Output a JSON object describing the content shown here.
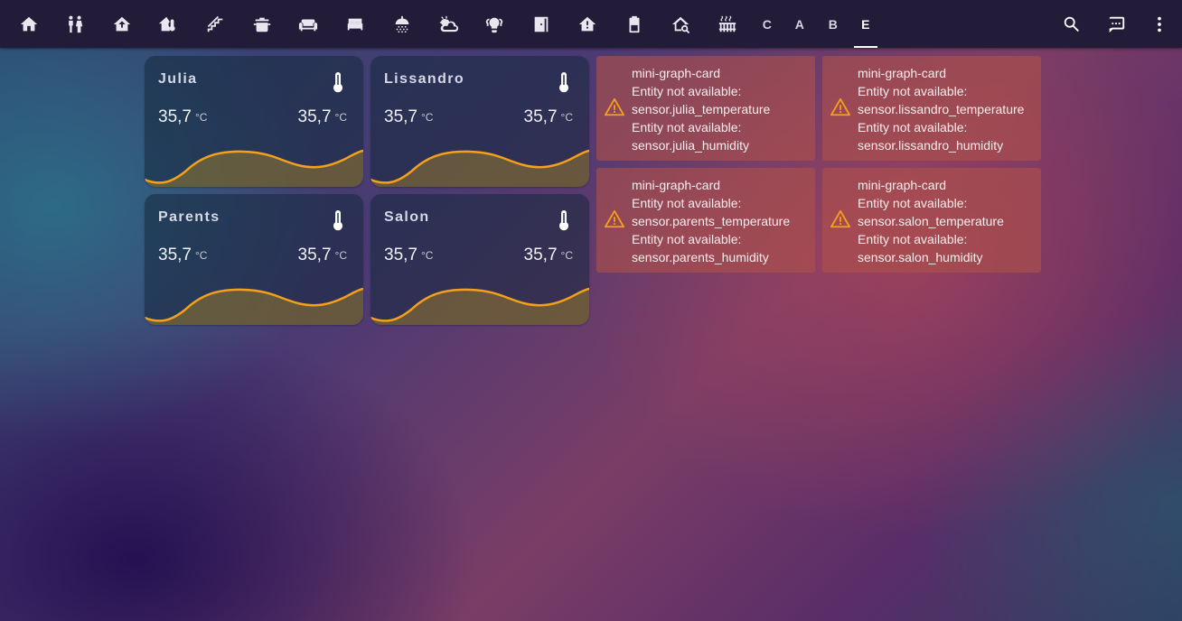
{
  "topbar": {
    "tabs": [
      {
        "name": "home-icon"
      },
      {
        "name": "family-icon"
      },
      {
        "name": "home-upload-icon"
      },
      {
        "name": "home-thermometer-icon"
      },
      {
        "name": "stairs-icon"
      },
      {
        "name": "pot-icon"
      },
      {
        "name": "sofa-icon"
      },
      {
        "name": "bed-icon"
      },
      {
        "name": "shower-icon"
      },
      {
        "name": "weather-icon"
      },
      {
        "name": "lightbulb-group-icon"
      },
      {
        "name": "door-icon"
      },
      {
        "name": "home-alert-icon"
      },
      {
        "name": "battery-icon"
      },
      {
        "name": "home-search-icon"
      },
      {
        "name": "radiator-icon"
      }
    ],
    "letter_tabs": [
      "C",
      "A",
      "B",
      "E"
    ],
    "active_tab": "E",
    "actions": [
      "search-icon",
      "message-icon",
      "more-vert-icon"
    ]
  },
  "sensor_cards": [
    {
      "name": "Julia",
      "temperature": "35,7",
      "temp_unit": "°C",
      "humidity": "35,7",
      "hum_unit": "°C"
    },
    {
      "name": "Lissandro",
      "temperature": "35,7",
      "temp_unit": "°C",
      "humidity": "35,7",
      "hum_unit": "°C"
    },
    {
      "name": "Parents",
      "temperature": "35,7",
      "temp_unit": "°C",
      "humidity": "35,7",
      "hum_unit": "°C"
    },
    {
      "name": "Salon",
      "temperature": "35,7",
      "temp_unit": "°C",
      "humidity": "35,7",
      "hum_unit": "°C"
    }
  ],
  "error_cards": [
    {
      "lines": [
        "mini-graph-card",
        "Entity not available:",
        "sensor.julia_temperature",
        "Entity not available:",
        "sensor.julia_humidity"
      ]
    },
    {
      "lines": [
        "mini-graph-card",
        "Entity not available:",
        "sensor.lissandro_temperature",
        "Entity not available:",
        "sensor.lissandro_humidity"
      ]
    },
    {
      "lines": [
        "mini-graph-card",
        "Entity not available:",
        "sensor.parents_temperature",
        "Entity not available:",
        "sensor.parents_humidity"
      ]
    },
    {
      "lines": [
        "mini-graph-card",
        "Entity not available:",
        "sensor.salon_temperature",
        "Entity not available:",
        "sensor.salon_humidity"
      ]
    }
  ],
  "colors": {
    "graph_line": "#f5a01a",
    "graph_fill": "#8a6a22",
    "warning": "#f5a01a",
    "topbar": "#231c38"
  }
}
